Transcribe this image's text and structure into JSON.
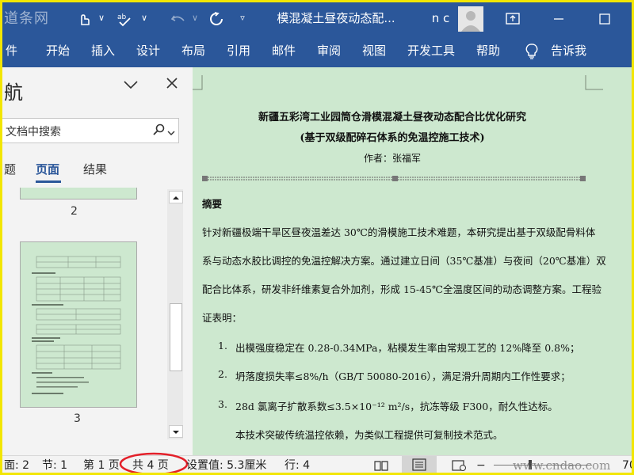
{
  "titlebar": {
    "watermark": "道条网",
    "doc_title": "模混凝土昼夜动态配...",
    "user": "n c"
  },
  "ribbon": {
    "tabs": [
      "件",
      "开始",
      "插入",
      "设计",
      "布局",
      "引用",
      "邮件",
      "审阅",
      "视图",
      "开发工具",
      "帮助"
    ],
    "tell_me": "告诉我"
  },
  "nav": {
    "title": "航",
    "search_placeholder": "文档中搜索",
    "tabs": [
      "题",
      "页面",
      "结果"
    ],
    "active_tab": "页面",
    "page_labels": [
      "2",
      "3"
    ]
  },
  "document": {
    "title_line1": "新疆五彩湾工业园筒仓滑模混凝土昼夜动态配合比优化研究",
    "title_line2": "(基于双级配碎石体系的免温控施工技术)",
    "author": "作者：张福军",
    "abstract_heading": "摘要",
    "paragraph_lines": [
      "针对新疆极端干旱区昼夜温差达 30℃的滑模施工技术难题，本研究提出基于双级配骨料体",
      "系与动态水胶比调控的免温控解决方案。通过建立日间（35℃基准）与夜间（20℃基准）双",
      "配合比体系，研发非纤维素复合外加剂，形成 15-45℃全温度区间的动态调整方案。工程验",
      "证表明："
    ],
    "list": [
      {
        "num": "1.",
        "text": "出模强度稳定在 0.28-0.34MPa，粘模发生率由常规工艺的 12%降至 0.8%；"
      },
      {
        "num": "2.",
        "text": "坍落度损失率≤8%/h（GB/T 50080-2016），满足滑升周期内工作性要求；"
      },
      {
        "num": "3.",
        "text": "28d 氯离子扩散系数≤3.5×10⁻¹² m²/s，抗冻等级 F300，耐久性达标。"
      }
    ],
    "closing": "本技术突破传统温控依赖，为类似工程提供可复制技术范式。"
  },
  "status": {
    "section_page": "面: 2",
    "section": "节: 1",
    "page_no": "第 1 页",
    "total_pages": "共 4 页",
    "position": "设置值: 5.3厘米",
    "line": "行: 4",
    "zoom_partial": "70",
    "watermark": "www.cndao.com"
  },
  "colors": {
    "ribbon": "#2b579a",
    "doc_bg": "#cde8cf",
    "frame": "#f2e600",
    "highlight_circle": "#e3202a"
  }
}
